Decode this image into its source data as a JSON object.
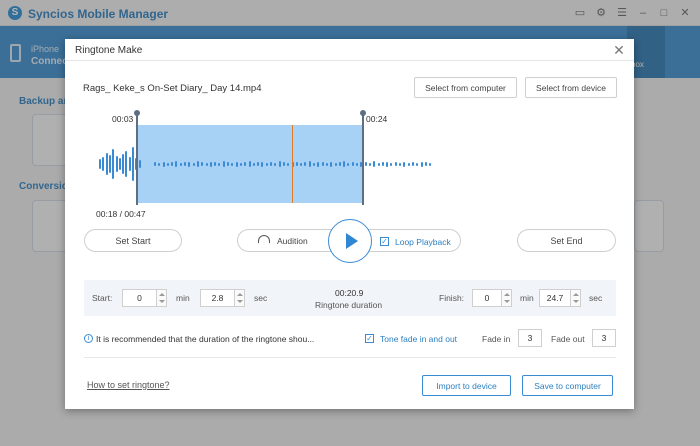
{
  "app": {
    "title": "Syncios Mobile Manager",
    "device_name": "iPhone",
    "device_status": "Connec",
    "toolbox_label": "box",
    "section_backup": "Backup an",
    "section_conversion": "Conversion"
  },
  "dialog": {
    "title": "Ringtone Make",
    "close_glyph": "✕",
    "file_name": "Rags_ Keke_s On-Set Diary_ Day 14.mp4",
    "select_from_computer": "Select from computer",
    "select_from_device": "Select from device",
    "start_marker_time": "00:03",
    "end_marker_time": "00:24",
    "position_time": "00:18 / 00:47",
    "set_start_label": "Set Start",
    "audition_label": "Audition",
    "loop_playback_label": "Loop Playback",
    "loop_playback_checked": true,
    "set_end_label": "Set End",
    "start_label": "Start:",
    "start_min": "0",
    "start_sec": "2.8",
    "min_unit": "min",
    "sec_unit": "sec",
    "duration_value": "00:20.9",
    "duration_label": "Ringtone duration",
    "finish_label": "Finish:",
    "finish_min": "0",
    "finish_sec": "24.7",
    "recommend_text": "It is recommended that the duration of the ringtone shou...",
    "tone_fade_label": "Tone fade in and out",
    "tone_fade_checked": true,
    "fade_in_label": "Fade in",
    "fade_in_value": "3",
    "fade_out_label": "Fade out",
    "fade_out_value": "3",
    "help_link": "How to set ringtone?",
    "import_to_device": "Import to device",
    "save_to_computer": "Save to computer"
  },
  "colors": {
    "accent": "#3b8bd4",
    "selection": "#a8d2f5",
    "playhead": "#e07b2a",
    "header": "#3a8fd1"
  },
  "icons": {
    "app_logo": "syncios-logo-icon",
    "play": "play-icon",
    "audition": "headphones-icon",
    "info": "info-icon",
    "close": "close-icon"
  }
}
